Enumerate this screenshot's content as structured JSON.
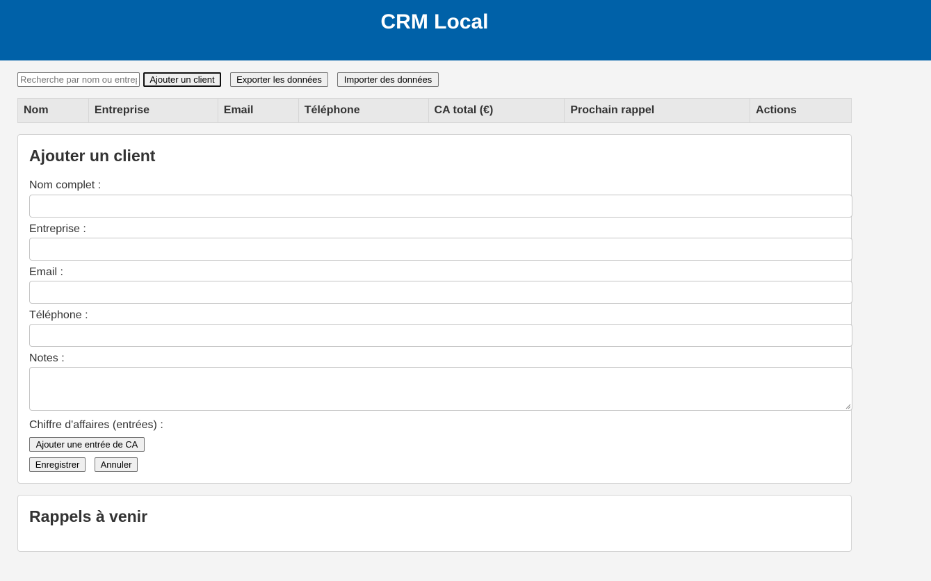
{
  "header": {
    "title": "CRM Local"
  },
  "toolbar": {
    "search_placeholder": "Recherche par nom ou entreprise",
    "add_client_label": "Ajouter un client",
    "export_label": "Exporter les données",
    "import_label": "Importer des données"
  },
  "table": {
    "columns": [
      "Nom",
      "Entreprise",
      "Email",
      "Téléphone",
      "CA total (€)",
      "Prochain rappel",
      "Actions"
    ]
  },
  "form": {
    "title": "Ajouter un client",
    "name_label": "Nom complet :",
    "company_label": "Entreprise :",
    "email_label": "Email :",
    "phone_label": "Téléphone :",
    "notes_label": "Notes :",
    "revenue_label": "Chiffre d'affaires (entrées) :",
    "add_revenue_label": "Ajouter une entrée de CA",
    "save_label": "Enregistrer",
    "cancel_label": "Annuler",
    "name_value": "",
    "company_value": "",
    "email_value": "",
    "phone_value": "",
    "notes_value": ""
  },
  "reminders": {
    "title": "Rappels à venir"
  },
  "colors": {
    "header_bg": "#0061a8",
    "page_bg": "#f4f4f4",
    "table_head_bg": "#e8e8e8"
  }
}
